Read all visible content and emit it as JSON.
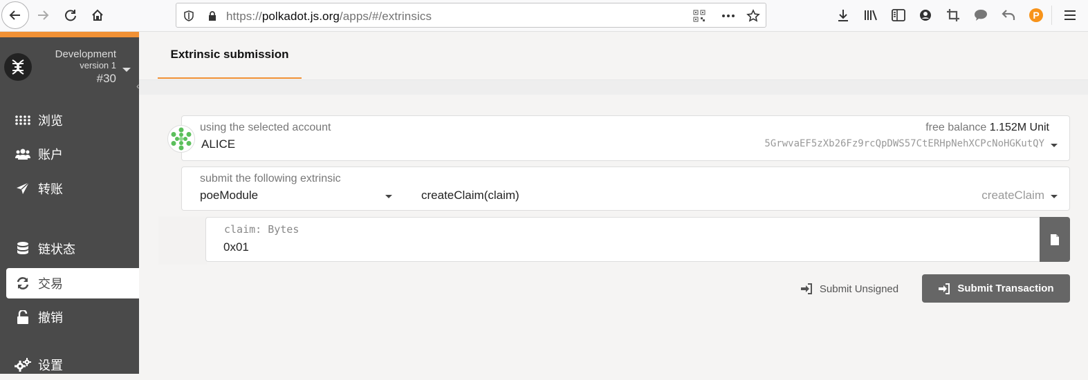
{
  "browser": {
    "url_prefix": "https://",
    "url_host": "polkadot.js.org",
    "url_path": "/apps/#/extrinsics"
  },
  "sidebar": {
    "chain_name": "Development",
    "chain_version": "version 1",
    "block": "#30",
    "items": [
      {
        "label": "浏览",
        "icon": "grid-icon"
      },
      {
        "label": "账户",
        "icon": "users-icon"
      },
      {
        "label": "转账",
        "icon": "paper-plane-icon"
      },
      {
        "label": "链状态",
        "icon": "database-icon"
      },
      {
        "label": "交易",
        "icon": "sync-icon"
      },
      {
        "label": "撤销",
        "icon": "unlock-icon"
      },
      {
        "label": "设置",
        "icon": "gears-icon"
      }
    ]
  },
  "main": {
    "tab": "Extrinsic submission",
    "account": {
      "label": "using the selected account",
      "name": "ALICE",
      "balance_label": "free balance",
      "balance_value": "1.152M Unit",
      "address": "5GrwvaEF5zXb26Fz9rcQpDWS57CtERHpNehXCPcNoHGKutQY"
    },
    "extrinsic": {
      "label": "submit the following extrinsic",
      "module": "poeModule",
      "method": "createClaim(claim)",
      "method_hint": "createClaim"
    },
    "param": {
      "label": "claim: Bytes",
      "value": "0x01"
    },
    "actions": {
      "unsigned": "Submit Unsigned",
      "submit": "Submit Transaction"
    }
  },
  "colors": {
    "accent": "#f19135",
    "sidebar": "#4a4a4a",
    "button": "#666666"
  }
}
